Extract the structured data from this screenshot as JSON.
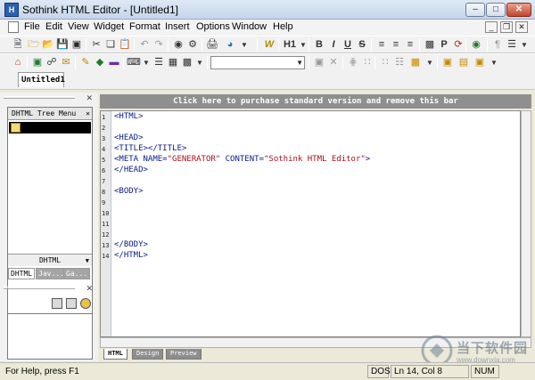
{
  "window": {
    "title": "Sothink HTML Editor - [Untitled1]",
    "app_icon_text": "H"
  },
  "menubar": {
    "items": [
      "File",
      "Edit",
      "View",
      "Widget",
      "Format",
      "Insert",
      "Options",
      "Window",
      "Help"
    ]
  },
  "toolbar": {
    "heading_select": "H1"
  },
  "document": {
    "tab_label": "Untitled1"
  },
  "left_panel": {
    "tree_header": "DHTML Tree Menu",
    "combo_value": "DHTML",
    "tabs": [
      "DHTML",
      "Jav...",
      "Ga..."
    ]
  },
  "editor": {
    "purchase_bar": "Click here to purchase standard version and remove this bar",
    "line_numbers": [
      "1",
      "2",
      "3",
      "4",
      "5",
      "6",
      "7",
      "8",
      "9",
      "10",
      "11",
      "12",
      "13",
      "14"
    ],
    "lines": {
      "l1": "<HTML>",
      "l3": "<HEAD>",
      "l4": "<TITLE></TITLE>",
      "l5_pre": "<META NAME=",
      "l5_name": "\"GENERATOR\"",
      "l5_mid": " CONTENT=",
      "l5_content": "\"Sothink HTML Editor\"",
      "l5_post": ">",
      "l6": "</HEAD>",
      "l8": "<BODY>",
      "l13": "</BODY>",
      "l14": "</HTML>"
    },
    "view_tabs": [
      "HTML",
      "Design",
      "Preview"
    ]
  },
  "statusbar": {
    "help": "For Help, press F1",
    "mode": "DOS",
    "position": "Ln 14, Col 8",
    "num": "NUM"
  },
  "watermark": {
    "title": "当下软件园",
    "sub": "www.downxia.com"
  }
}
